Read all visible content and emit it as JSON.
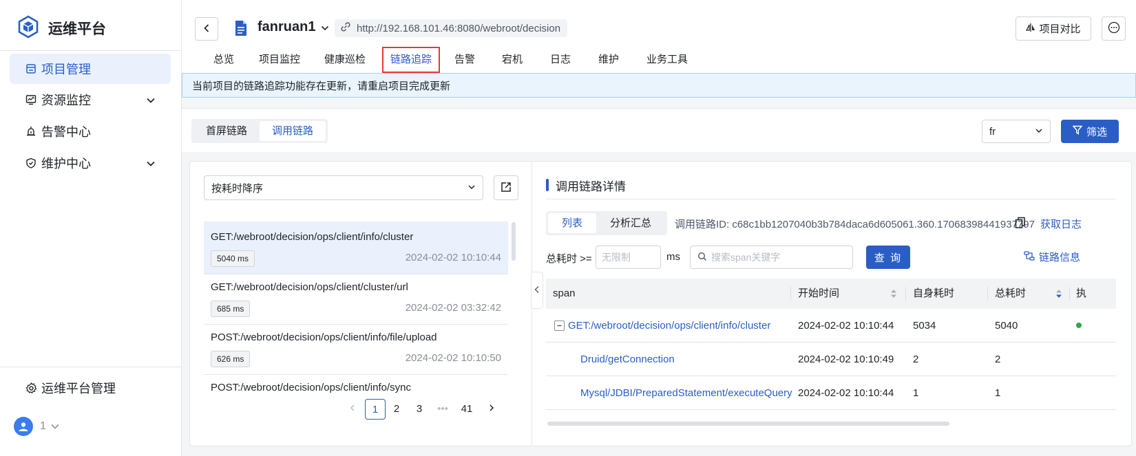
{
  "sidebar": {
    "brand": "运维平台",
    "items": [
      {
        "label": "项目管理",
        "icon": "list-icon"
      },
      {
        "label": "资源监控",
        "icon": "monitor-icon"
      },
      {
        "label": "告警中心",
        "icon": "alarm-icon"
      },
      {
        "label": "维护中心",
        "icon": "shield-icon"
      }
    ],
    "admin": {
      "label": "运维平台管理",
      "icon": "gear-icon"
    },
    "user": {
      "id": "1"
    }
  },
  "header": {
    "project_name": "fanruan1",
    "url": "http://192.168.101.46:8080/webroot/decision",
    "compare_label": "项目对比",
    "tabs": [
      "总览",
      "项目监控",
      "健康巡检",
      "链路追踪",
      "告警",
      "宕机",
      "日志",
      "维护",
      "业务工具"
    ],
    "active_tab": "链路追踪"
  },
  "notice": "当前项目的链路追踪功能存在更新，请重启项目完成更新",
  "subbar": {
    "segments": [
      "首屏链路",
      "调用链路"
    ],
    "active_segment": "调用链路",
    "app_select": "fr",
    "filter_label": "筛选"
  },
  "left": {
    "sort_select": "按耗时降序",
    "traces": [
      {
        "path": "GET:/webroot/decision/ops/client/info/cluster",
        "duration": "5040 ms",
        "time": "2024-02-02 10:10:44"
      },
      {
        "path": "GET:/webroot/decision/ops/client/cluster/url",
        "duration": "685 ms",
        "time": "2024-02-02 03:32:42"
      },
      {
        "path": "POST:/webroot/decision/ops/client/info/file/upload",
        "duration": "626 ms",
        "time": "2024-02-02 10:10:50"
      },
      {
        "path": "POST:/webroot/decision/ops/client/info/sync",
        "duration": "",
        "time": ""
      }
    ],
    "pager": {
      "pages": [
        "1",
        "2",
        "3",
        "•••",
        "41"
      ],
      "current": "1"
    }
  },
  "right": {
    "title": "调用链路详情",
    "segments": [
      "列表",
      "分析汇总"
    ],
    "active_segment": "列表",
    "trace_id": "调用链路ID: c68c1bb1207040b3b784daca6d605061.360.17068398441937797",
    "get_log": "获取日志",
    "cost_label": "总耗时 >=",
    "cost_placeholder": "无限制",
    "ms": "ms",
    "search_placeholder": "搜索span关键字",
    "query_label": "查 询",
    "chain_info": "链路信息",
    "columns": [
      "span",
      "开始时间",
      "自身耗时",
      "总耗时",
      "执"
    ],
    "rows": [
      {
        "span": "GET:/webroot/decision/ops/client/info/cluster",
        "start": "2024-02-02 10:10:44",
        "self": "5034",
        "total": "5040"
      },
      {
        "span": "Druid/getConnection",
        "start": "2024-02-02 10:10:49",
        "self": "2",
        "total": "2"
      },
      {
        "span": "Mysql/JDBI/PreparedStatement/executeQuery",
        "start": "2024-02-02 10:10:44",
        "self": "1",
        "total": "1"
      }
    ]
  },
  "colors": {
    "accent": "#2a5ec6",
    "highlight_border": "#e53935",
    "status_ok": "#2ba84a"
  }
}
